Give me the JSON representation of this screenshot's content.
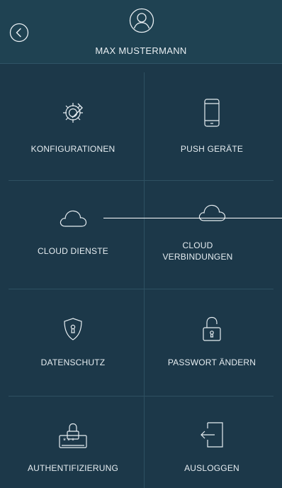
{
  "header": {
    "user_name": "MAX MUSTERMANN"
  },
  "icons": {
    "back": "chevron-left-circle",
    "user": "user-circle"
  },
  "menu": {
    "items": [
      {
        "label": "KONFIGURATIONEN",
        "icon": "gear-wrench-icon"
      },
      {
        "label": "PUSH GERÄTE",
        "icon": "smartphone-icon"
      },
      {
        "label": "CLOUD DIENSTE",
        "icon": "cloud-icon"
      },
      {
        "label": "CLOUD VERBINDUNGEN",
        "icon": "cloud-icon"
      },
      {
        "label": "DATENSCHUTZ",
        "icon": "shield-lock-icon"
      },
      {
        "label": "PASSWORT ÄNDERN",
        "icon": "padlock-open-icon"
      },
      {
        "label": "AUTHENTIFIZIERUNG",
        "icon": "password-card-icon"
      },
      {
        "label": "AUSLOGGEN",
        "icon": "logout-icon"
      }
    ]
  },
  "colors": {
    "background": "#1c3849",
    "header": "#1f4252",
    "divider": "#2e5061",
    "text": "#e6edf1"
  }
}
